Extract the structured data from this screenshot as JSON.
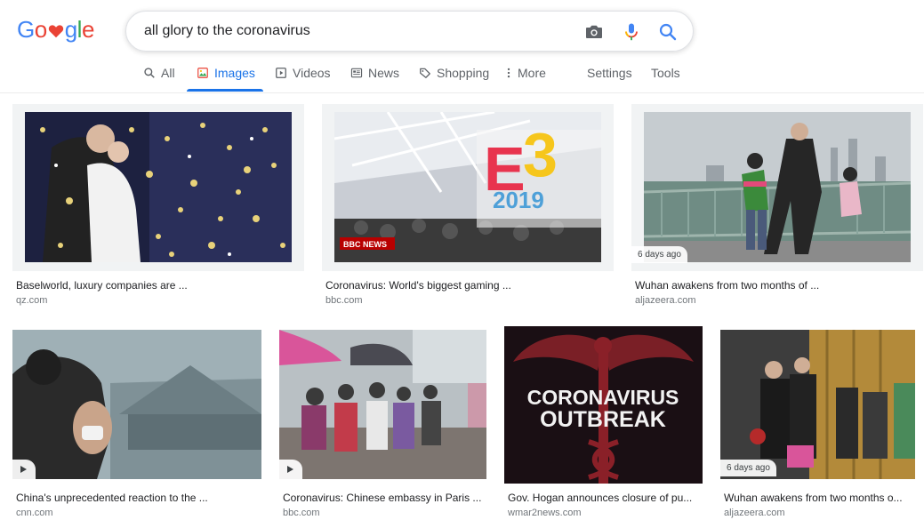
{
  "logo": {
    "letters": [
      "G",
      "o",
      "g",
      "l",
      "e"
    ]
  },
  "search": {
    "query": "all glory to the coronavirus"
  },
  "tabs": [
    {
      "label": "All",
      "icon": "search-icon"
    },
    {
      "label": "Images",
      "icon": "image-icon"
    },
    {
      "label": "Videos",
      "icon": "play-icon"
    },
    {
      "label": "News",
      "icon": "news-icon"
    },
    {
      "label": "Shopping",
      "icon": "tag-icon"
    },
    {
      "label": "More",
      "icon": "more-vert-icon"
    }
  ],
  "tools": {
    "settings": "Settings",
    "tools": "Tools"
  },
  "results": [
    {
      "caption": "Baselworld, luxury companies are ...",
      "source": "qz.com"
    },
    {
      "caption": "Coronavirus: World's biggest gaming ...",
      "source": "bbc.com",
      "overlay_logo": "BBC NEWS",
      "image_text": [
        "E",
        "3",
        "2019"
      ]
    },
    {
      "caption": "Wuhan awakens from two months of ...",
      "source": "aljazeera.com",
      "badge": "6 days ago"
    },
    {
      "caption": "China's unprecedented reaction to the ...",
      "source": "cnn.com",
      "video": true
    },
    {
      "caption": "Coronavirus: Chinese embassy in Paris ...",
      "source": "bbc.com",
      "video": true
    },
    {
      "caption": "Gov. Hogan announces closure of pu...",
      "source": "wmar2news.com",
      "image_text": [
        "CORONAVIRUS",
        "OUTBREAK"
      ]
    },
    {
      "caption": "Wuhan awakens from two months o...",
      "source": "aljazeera.com",
      "badge": "6 days ago"
    }
  ],
  "colors": {
    "blue": "#4285f4",
    "red": "#ea4335",
    "yellow": "#fbbc05",
    "green": "#34a853",
    "accent": "#1a73e8"
  }
}
